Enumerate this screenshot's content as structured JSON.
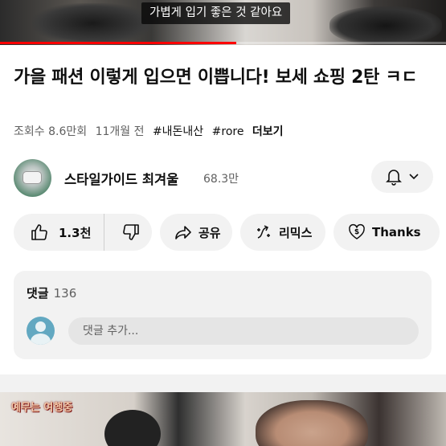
{
  "video": {
    "caption": "가볍게 입기 좋은 것 같아요",
    "progress_fraction": 0.53,
    "progress_color": "#ff0000"
  },
  "title": "가을 패션 이렇게 입으면 이쁩니다! 보세 쇼핑 2탄 ㅋㄷ",
  "meta": {
    "views": "조회수 8.6만회",
    "age": "11개월 전",
    "tags": [
      "#내돈내산",
      "#rore"
    ],
    "more": "더보기"
  },
  "channel": {
    "name": "스타일가이드 최겨울",
    "subscribers": "68.3만",
    "bell_icon": "bell-icon",
    "chevron_icon": "chevron-down-icon"
  },
  "actions": {
    "like_count": "1.3천",
    "share_label": "공유",
    "remix_label": "리믹스",
    "thanks_label": "Thanks"
  },
  "comments": {
    "label": "댓글",
    "count": "136",
    "placeholder": "댓글 추가..."
  },
  "next_video": {
    "thumb_text": "예무는 여행중"
  }
}
